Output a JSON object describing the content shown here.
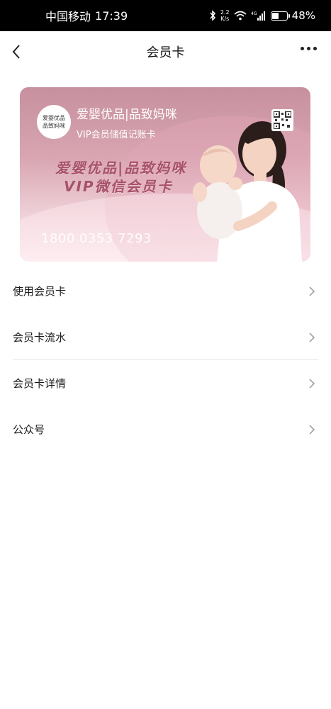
{
  "status_bar": {
    "carrier": "中国移动",
    "time": "17:39",
    "net_speed_value": "2.2",
    "net_speed_unit": "K/s",
    "network_type": "4G",
    "battery": "48%",
    "battery_level": 0.48
  },
  "nav": {
    "title": "会员卡",
    "back_icon": "chevron-left-icon",
    "more_icon": "more-dots-icon"
  },
  "card": {
    "logo_line1": "爱婴优品",
    "logo_line2": "品致妈咪",
    "brand_name": "爱婴优品|品致妈咪",
    "subtitle": "VIP会员储值记账卡",
    "slogan_line1": "爱婴优品|品致妈咪",
    "slogan_line2": "VIP微信会员卡",
    "card_number": "1800 0353 7293",
    "accent_color": "#c7909e"
  },
  "menu": {
    "items": [
      {
        "label": "使用会员卡"
      },
      {
        "label": "会员卡流水"
      },
      {
        "label": "会员卡详情"
      },
      {
        "label": "公众号"
      }
    ]
  }
}
